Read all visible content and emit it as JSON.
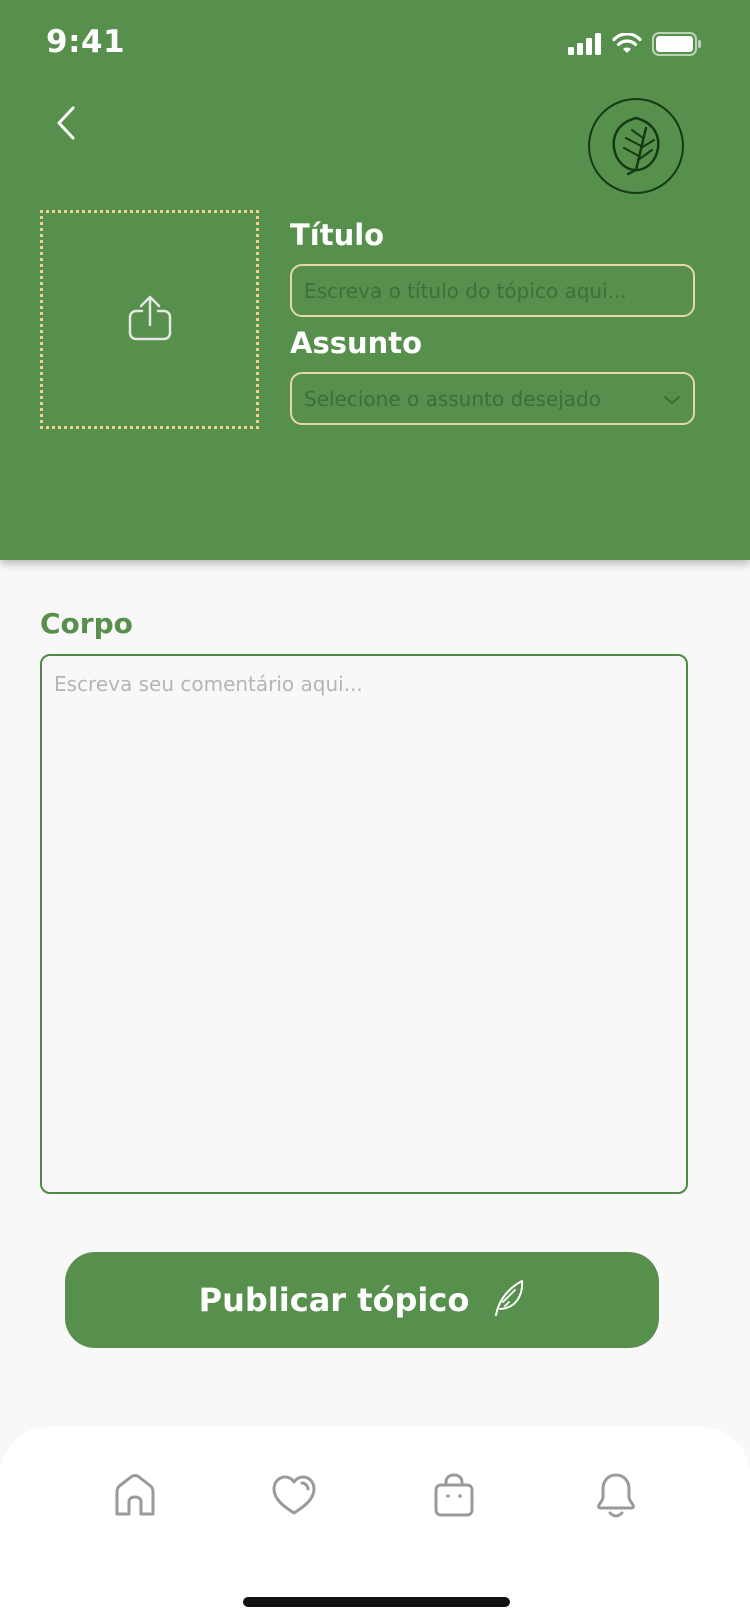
{
  "status_bar": {
    "time": "9:41"
  },
  "header": {
    "title_label": "Título",
    "title_placeholder": "Escreva o título do tópico aqui...",
    "subject_label": "Assunto",
    "subject_placeholder": "Selecione o assunto desejado"
  },
  "body": {
    "label": "Corpo",
    "placeholder": "Escreva seu comentário aqui..."
  },
  "publish_button": {
    "label": "Publicar tópico"
  },
  "bottom_nav": [
    "home-icon",
    "heart-icon",
    "shopping-bag-icon",
    "bell-icon"
  ],
  "colors": {
    "primary_green": "#578f4c",
    "dark_green": "#163a13",
    "input_border": "#e5d8a3",
    "upload_border": "#e8d48f",
    "background": "#f8f8f8"
  }
}
